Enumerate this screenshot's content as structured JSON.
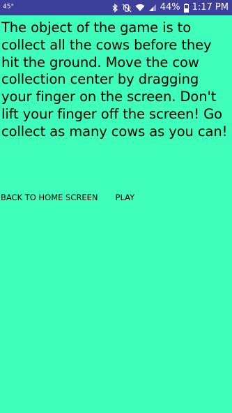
{
  "status_bar": {
    "temperature": "45°",
    "battery_percent": "44%",
    "time": "1:17 PM",
    "icons": [
      "bluetooth-icon",
      "vibrate-mute-icon",
      "wifi-icon",
      "cell-signal-icon",
      "battery-icon"
    ],
    "background_color": "#3e3f9a"
  },
  "main": {
    "background_color": "#3ffdba",
    "instructions": "The object of the game is to collect all the cows before they hit the ground. Move the cow collection center by dragging your finger on the screen. Don't lift your finger off the screen! Go collect as many cows as you can!",
    "back_button_label": "BACK TO HOME SCREEN",
    "play_button_label": "PLAY"
  }
}
